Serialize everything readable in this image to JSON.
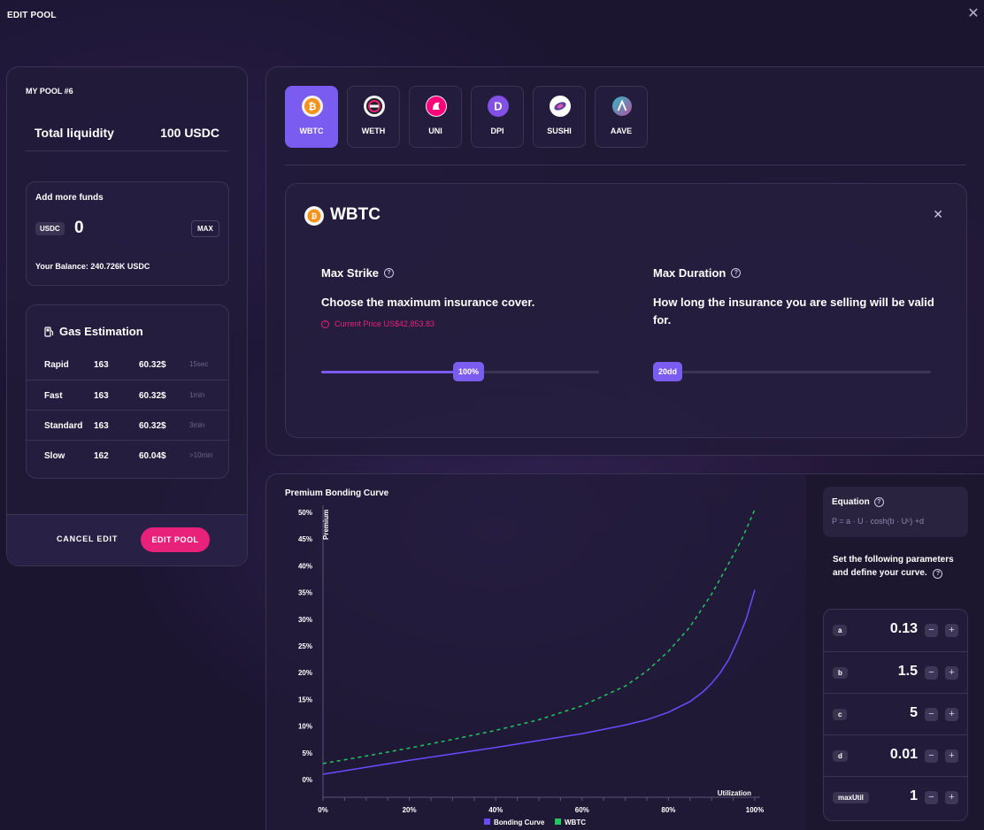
{
  "window": {
    "title": "EDIT POOL",
    "close_icon": "close-icon"
  },
  "pool": {
    "name": "MY POOL #6",
    "liquidity_label": "Total liquidity",
    "liquidity_value": "100 USDC",
    "add_funds": {
      "title": "Add more funds",
      "currency": "USDC",
      "amount": "0",
      "max_label": "MAX",
      "balance": "Your Balance: 240.726K USDC"
    },
    "gas": {
      "title": "Gas Estimation",
      "icon": "fuel-pump-icon",
      "rows": [
        {
          "name": "Rapid",
          "gwei": "163",
          "usd": "60.32$",
          "time": "15sec"
        },
        {
          "name": "Fast",
          "gwei": "163",
          "usd": "60.32$",
          "time": "1min"
        },
        {
          "name": "Standard",
          "gwei": "163",
          "usd": "60.32$",
          "time": "3min"
        },
        {
          "name": "Slow",
          "gwei": "162",
          "usd": "60.04$",
          "time": ">10min"
        }
      ]
    },
    "cancel_label": "CANCEL EDIT",
    "edit_label": "EDIT POOL"
  },
  "tokens": [
    {
      "label": "WBTC",
      "icon": "wbtc-icon",
      "active": true
    },
    {
      "label": "WETH",
      "icon": "weth-icon",
      "active": false
    },
    {
      "label": "UNI",
      "icon": "uni-icon",
      "active": false
    },
    {
      "label": "DPI",
      "icon": "dpi-icon",
      "active": false
    },
    {
      "label": "SUSHI",
      "icon": "sushi-icon",
      "active": false
    },
    {
      "label": "AAVE",
      "icon": "aave-icon",
      "active": false
    }
  ],
  "token_card": {
    "name": "WBTC",
    "max_strike": {
      "title": "Max Strike",
      "description": "Choose the maximum insurance cover.",
      "current_price": "Current Price US$42,853.83",
      "slider_label": "100%",
      "slider_value": 0.5
    },
    "max_duration": {
      "title": "Max Duration",
      "description": "How long the insurance you are selling will be valid for.",
      "slider_label": "20dd",
      "slider_value": 0.02
    }
  },
  "equation": {
    "title": "Equation",
    "formula": "P = a · U · cosh(b · Uᶜ) +d",
    "intro": "Set the following parameters and define your curve.",
    "params": [
      {
        "name": "a",
        "value": "0.13"
      },
      {
        "name": "b",
        "value": "1.5"
      },
      {
        "name": "c",
        "value": "5"
      },
      {
        "name": "d",
        "value": "0.01"
      },
      {
        "name": "maxUtil",
        "value": "1"
      }
    ]
  },
  "colors": {
    "accent": "#7b5cf0",
    "pink": "#e8217a",
    "green": "#22c55e"
  },
  "chart_data": {
    "type": "line",
    "title": "Premium Bonding Curve",
    "ylabel": "Premium",
    "xlabel": "Utilization",
    "x_ticks": [
      "0%",
      "20%",
      "40%",
      "60%",
      "80%",
      "100%"
    ],
    "y_ticks": [
      "0%",
      "5%",
      "10%",
      "15%",
      "20%",
      "25%",
      "30%",
      "35%",
      "40%",
      "45%",
      "50%"
    ],
    "xlim": [
      0,
      100
    ],
    "ylim": [
      0,
      50
    ],
    "grid": false,
    "legend_position": "bottom",
    "series": [
      {
        "name": "Bonding Curve",
        "color": "#6a4cff",
        "dashed": false,
        "x": [
          0,
          10,
          20,
          30,
          40,
          50,
          60,
          70,
          75,
          80,
          85,
          88,
          90,
          92,
          94,
          96,
          98,
          100
        ],
        "y": [
          1,
          2.3,
          3.6,
          4.8,
          6.0,
          7.3,
          8.6,
          10.2,
          11.2,
          12.6,
          14.6,
          16.4,
          18.0,
          20.0,
          22.5,
          26.0,
          30.0,
          35.5
        ]
      },
      {
        "name": "WBTC",
        "color": "#22c55e",
        "dashed": true,
        "x": [
          0,
          10,
          20,
          30,
          40,
          50,
          60,
          70,
          75,
          80,
          85,
          90,
          94,
          97,
          100
        ],
        "y": [
          3,
          4.4,
          5.9,
          7.5,
          9.2,
          11.2,
          13.8,
          17.5,
          20.3,
          24.0,
          28.6,
          34.7,
          40.5,
          45.0,
          50.5
        ]
      }
    ]
  }
}
